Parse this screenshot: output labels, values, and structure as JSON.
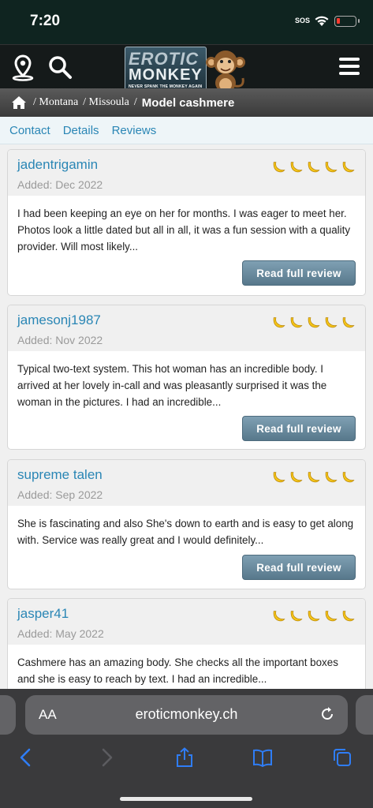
{
  "status": {
    "time": "7:20",
    "sos": "SOS"
  },
  "logo": {
    "line1": "EROTIC",
    "line2": "MONKEY",
    "tagline": "NEVER SPANK THE MONKEY AGAIN"
  },
  "breadcrumb": {
    "items": [
      "/ Montana",
      "/ Missoula",
      "/"
    ],
    "current": "Model cashmere"
  },
  "tabs": [
    "Contact",
    "Details",
    "Reviews"
  ],
  "colors": {
    "accent": "#2a86b5",
    "button": "#6b8ea1",
    "banana": "#f5c518"
  },
  "reviews": [
    {
      "author": "jadentrigamin",
      "added": "Added: Dec 2022",
      "rating": 5,
      "text": "I had been keeping an eye on her for months. I was eager to meet her. Photos look a little dated but all in all, it was a fun session with a quality provider. Will most likely...",
      "button": "Read full review"
    },
    {
      "author": "jamesonj1987",
      "added": "Added: Nov 2022",
      "rating": 5,
      "text": "Typical two-text system. This hot woman has an incredible body. I arrived at her lovely in-call and was pleasantly surprised it was the woman in the pictures. I had an incredible...",
      "button": "Read full review"
    },
    {
      "author": "supreme talen",
      "added": "Added: Sep 2022",
      "rating": 5,
      "text": "She is fascinating and also She's down to earth and is easy to get along with. Service was really great and I would definitely...",
      "button": "Read full review"
    },
    {
      "author": "jasper41",
      "added": "Added: May 2022",
      "rating": 5,
      "text": "Cashmere has an amazing body. She checks all the important boxes and she is easy to reach by text. I had an incredible...",
      "button": ""
    }
  ],
  "browser": {
    "aa": "AA",
    "url": "eroticmonkey.ch"
  },
  "icons": [
    "wifi-icon",
    "battery-icon",
    "location-pin-icon",
    "search-icon",
    "hamburger-menu-icon",
    "monkey-mascot-icon",
    "home-icon",
    "banana-icon",
    "reload-icon",
    "back-icon",
    "forward-icon",
    "share-icon",
    "bookmarks-icon",
    "tabs-icon"
  ]
}
